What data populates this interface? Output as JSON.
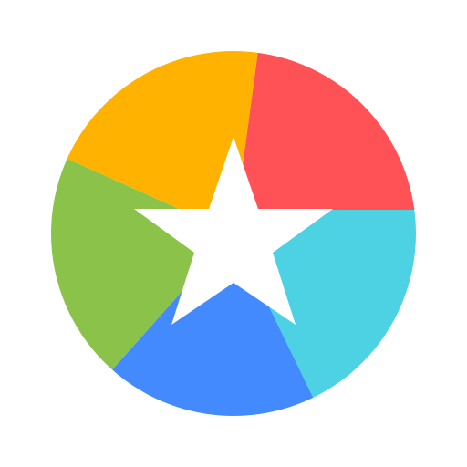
{
  "icon": {
    "name": "star-in-colored-circle",
    "background": "#FFFFFF",
    "center_star_color": "#FFFFFF",
    "segments": [
      {
        "name": "red-segment",
        "color": "#FF5257"
      },
      {
        "name": "cyan-segment",
        "color": "#4DD2E3"
      },
      {
        "name": "blue-segment",
        "color": "#448AFF"
      },
      {
        "name": "green-segment",
        "color": "#8BC34A"
      },
      {
        "name": "orange-segment",
        "color": "#FFB300"
      }
    ]
  }
}
